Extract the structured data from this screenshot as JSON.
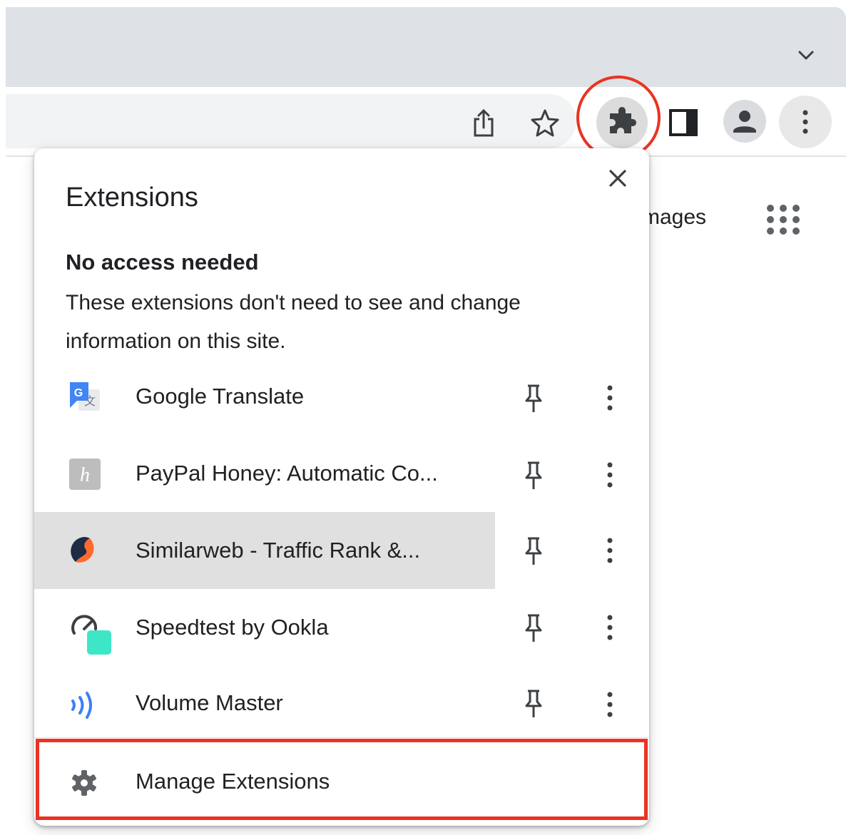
{
  "browser": {
    "toolbar_icons": [
      "share-icon",
      "bookmark-star-icon",
      "extensions-puzzle-icon",
      "side-panel-icon",
      "profile-avatar-icon",
      "chrome-menu-icon"
    ],
    "page_link_images": "mages",
    "highlight_color": "#ea3323"
  },
  "popup": {
    "title": "Extensions",
    "section_heading": "No access needed",
    "section_description": "These extensions don't need to see and change information on this site.",
    "extensions": [
      {
        "name": "Google Translate",
        "icon": "google-translate-icon"
      },
      {
        "name": "PayPal Honey: Automatic Co...",
        "icon": "honey-icon"
      },
      {
        "name": "Similarweb - Traffic Rank &...",
        "icon": "similarweb-icon",
        "hovered": true
      },
      {
        "name": "Speedtest by Ookla",
        "icon": "speedtest-icon"
      },
      {
        "name": "Volume Master",
        "icon": "volume-master-icon"
      }
    ],
    "manage_label": "Manage Extensions"
  }
}
